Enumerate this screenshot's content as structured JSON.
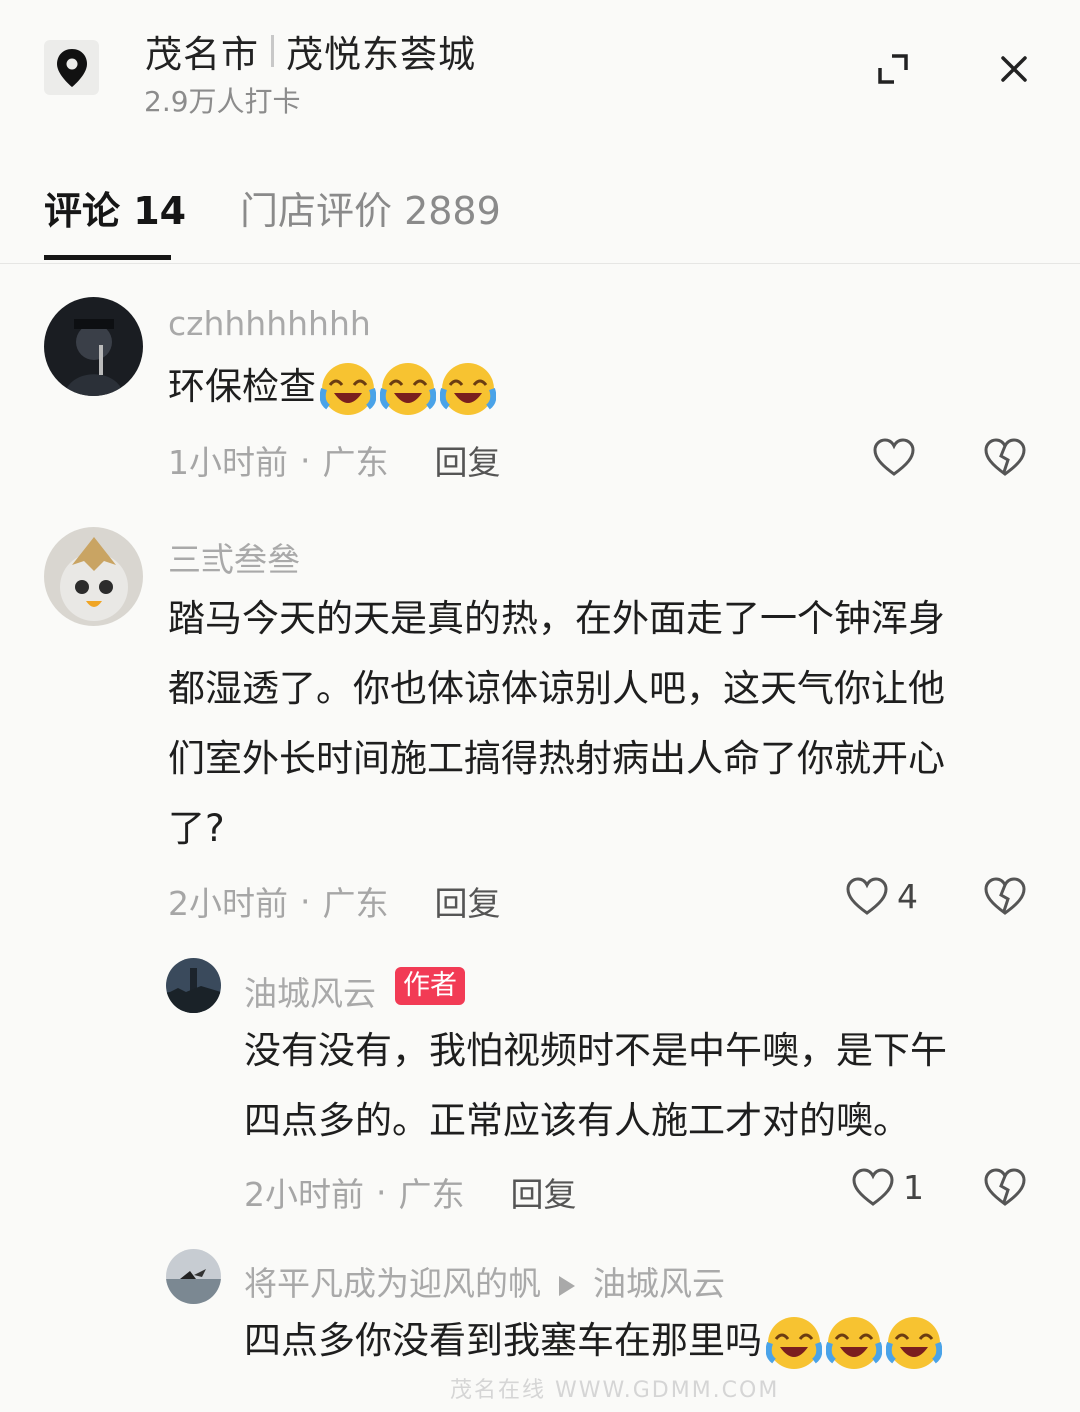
{
  "header": {
    "city": "茂名市",
    "place": "茂悦东荟城",
    "checkins": "2.9万人打卡"
  },
  "tabs": [
    {
      "label": "评论 14"
    },
    {
      "label": "门店评价 2889"
    }
  ],
  "comments": [
    {
      "username": "czhhhhhhhh",
      "text": "环保检查",
      "emoji_count": 3,
      "time": "1小时前",
      "region": "广东",
      "reply_label": "回复",
      "likes": ""
    },
    {
      "username": "三弎叁叄",
      "text_lines": [
        "踏马今天的天是真的热，在外面走了一个钟浑身",
        "都湿透了。你也体谅体谅别人吧，这天气你让他",
        "们室外长时间施工搞得热射病出人命了你就开心",
        "了?"
      ],
      "time": "2小时前",
      "region": "广东",
      "reply_label": "回复",
      "likes": "4"
    }
  ],
  "replies": [
    {
      "username": "油城风云",
      "badge": "作者",
      "text_lines": [
        "没有没有，我怕视频时不是中午噢，是下午",
        "四点多的。正常应该有人施工才对的噢。"
      ],
      "time": "2小时前",
      "region": "广东",
      "reply_label": "回复",
      "likes": "1"
    },
    {
      "username": "将平凡成为迎风的帆",
      "reply_to": "油城风云",
      "text": "四点多你没看到我塞车在那里吗",
      "emoji_count": 3
    }
  ],
  "watermark": "茂名在线 WWW.GDMM.COM",
  "colors": {
    "accent_badge": "#f23b55",
    "background": "#fafaf8",
    "muted_text": "#a6a6a6"
  }
}
